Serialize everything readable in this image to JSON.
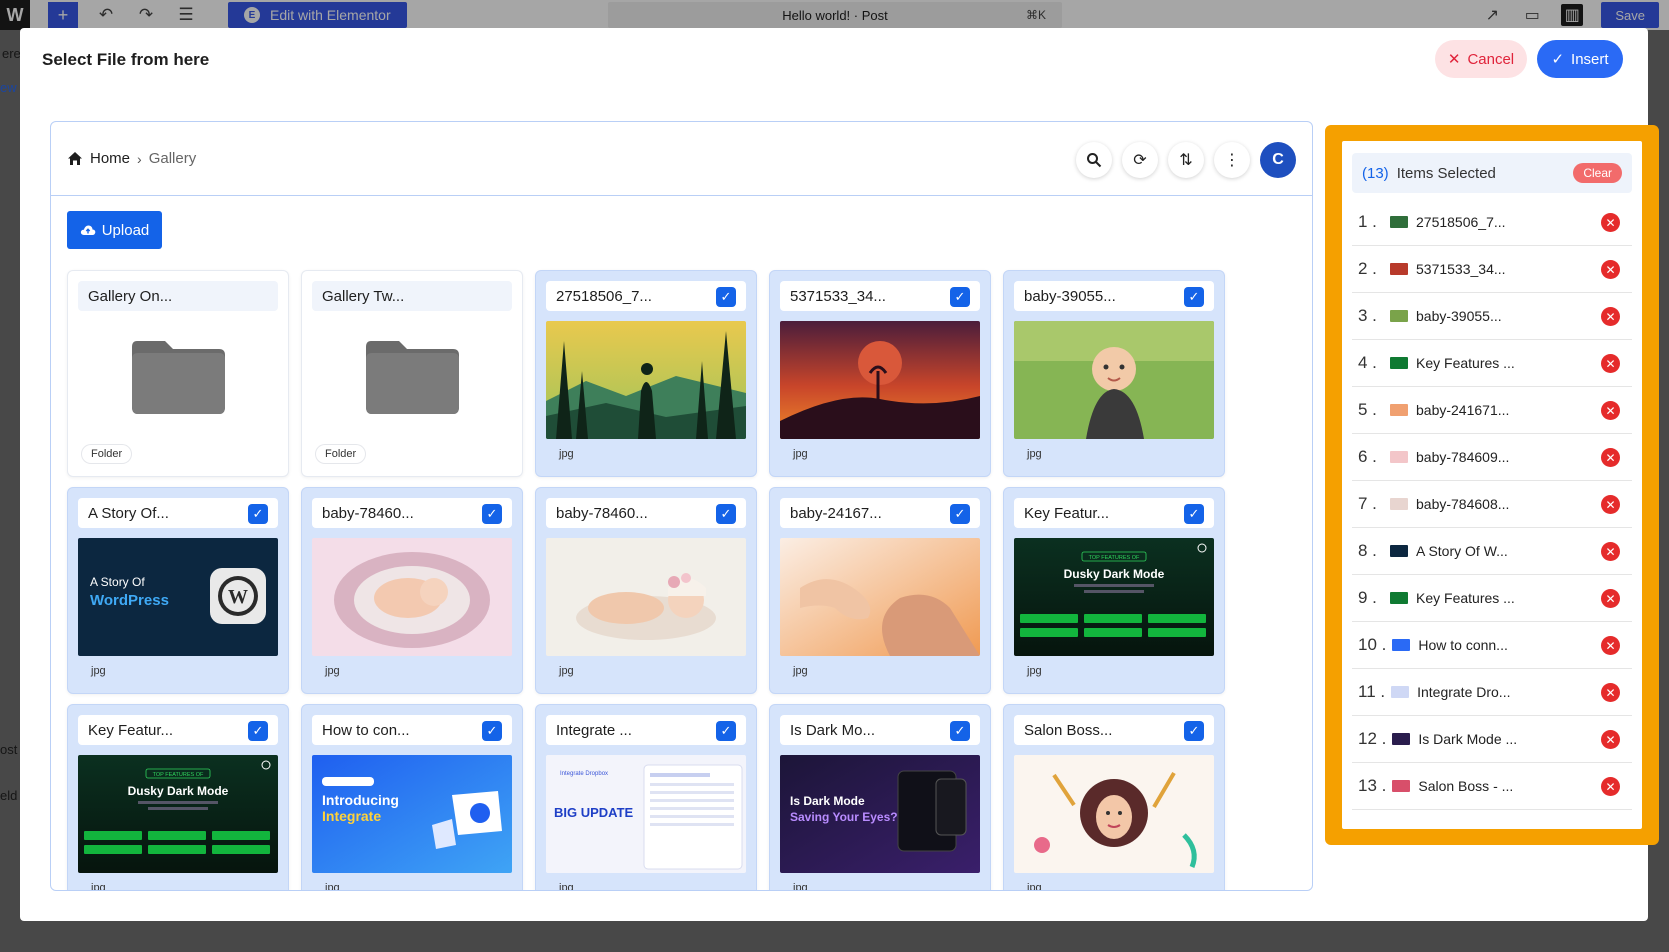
{
  "wp_bar": {
    "add_icon": "plus-icon",
    "elementor_label": "Edit with Elementor",
    "doc_title": "Hello world! · Post",
    "shortcut": "⌘K",
    "save_label": "Save"
  },
  "background_text": {
    "left_1": "ere",
    "left_2": "ew l",
    "left_3": "ost",
    "left_4": "eld",
    "right_1": "4"
  },
  "modal": {
    "title": "Select File from here",
    "cancel_label": "Cancel",
    "insert_label": "Insert"
  },
  "browser": {
    "breadcrumb": {
      "home": "Home",
      "current": "Gallery"
    },
    "tools": [
      "search-icon",
      "refresh-icon",
      "sort-icon",
      "more-icon",
      "brand-icon"
    ],
    "upload_label": "Upload",
    "items": [
      {
        "name": "Gallery On...",
        "type": "Folder",
        "selected": false,
        "thumb": "folder"
      },
      {
        "name": "Gallery Tw...",
        "type": "Folder",
        "selected": false,
        "thumb": "folder"
      },
      {
        "name": "27518506_7...",
        "type": "jpg",
        "selected": true,
        "thumb": "forest"
      },
      {
        "name": "5371533_34...",
        "type": "jpg",
        "selected": true,
        "thumb": "sunset"
      },
      {
        "name": "baby-39055...",
        "type": "jpg",
        "selected": true,
        "thumb": "grass"
      },
      {
        "name": "A Story Of...",
        "type": "jpg",
        "selected": true,
        "thumb": "wp",
        "thumb_line1": "A Story Of",
        "thumb_line2": "WordPress"
      },
      {
        "name": "baby-78460...",
        "type": "jpg",
        "selected": true,
        "thumb": "nest"
      },
      {
        "name": "baby-78460...",
        "type": "jpg",
        "selected": true,
        "thumb": "sleep"
      },
      {
        "name": "baby-24167...",
        "type": "jpg",
        "selected": true,
        "thumb": "hand"
      },
      {
        "name": "Key Featur...",
        "type": "jpg",
        "selected": true,
        "thumb": "dark",
        "thumb_line1": "TOP FEATURES OF",
        "thumb_line2": "Dusky Dark Mode"
      },
      {
        "name": "Key Featur...",
        "type": "jpg",
        "selected": true,
        "thumb": "dark",
        "thumb_line1": "TOP FEATURES OF",
        "thumb_line2": "Dusky Dark Mode"
      },
      {
        "name": "How to con...",
        "type": "jpg",
        "selected": true,
        "thumb": "blue",
        "thumb_line1": "Introducing",
        "thumb_line2": "Integrate"
      },
      {
        "name": "Integrate ...",
        "type": "jpg",
        "selected": true,
        "thumb": "update",
        "thumb_line1": "Integrate Dropbox",
        "thumb_line2": "BIG UPDATE"
      },
      {
        "name": "Is Dark Mo...",
        "type": "jpg",
        "selected": true,
        "thumb": "purple",
        "thumb_line1": "Is Dark Mode",
        "thumb_line2": "Saving Your Eyes?"
      },
      {
        "name": "Salon Boss...",
        "type": "jpg",
        "selected": true,
        "thumb": "salon"
      }
    ]
  },
  "selection": {
    "count": "(13)",
    "label": "Items Selected",
    "clear_label": "Clear",
    "items": [
      {
        "num": "1 .",
        "name": "27518506_7...",
        "thumb_color": "#2f6e3a"
      },
      {
        "num": "2 .",
        "name": "5371533_34...",
        "thumb_color": "#b83a2b"
      },
      {
        "num": "3 .",
        "name": "baby-39055...",
        "thumb_color": "#7aa34a"
      },
      {
        "num": "4 .",
        "name": "Key Features ...",
        "thumb_color": "#0f7a32"
      },
      {
        "num": "5 .",
        "name": "baby-241671...",
        "thumb_color": "#f0a070"
      },
      {
        "num": "6 .",
        "name": "baby-784609...",
        "thumb_color": "#f3c6c9"
      },
      {
        "num": "7 .",
        "name": "baby-784608...",
        "thumb_color": "#e8d5d0"
      },
      {
        "num": "8 .",
        "name": "A Story Of W...",
        "thumb_color": "#0c2740"
      },
      {
        "num": "9 .",
        "name": "Key Features ...",
        "thumb_color": "#0f7a32"
      },
      {
        "num": "10 .",
        "name": "How to conn...",
        "thumb_color": "#2a6af5"
      },
      {
        "num": "11 .",
        "name": "Integrate Dro...",
        "thumb_color": "#cfd8f5"
      },
      {
        "num": "12 .",
        "name": "Is Dark Mode ...",
        "thumb_color": "#2a1d4d"
      },
      {
        "num": "13 .",
        "name": "Salon Boss - ...",
        "thumb_color": "#d84f6a"
      }
    ]
  }
}
